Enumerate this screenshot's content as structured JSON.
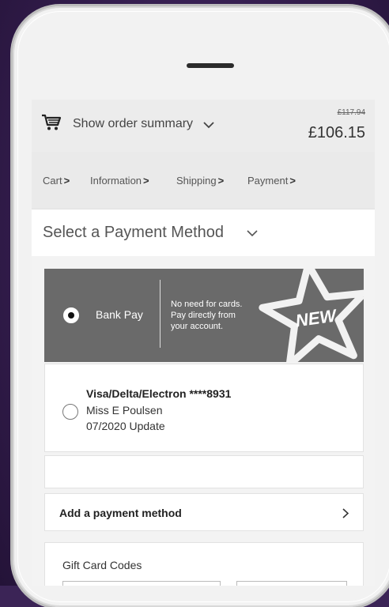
{
  "order_summary": {
    "label": "Show order summary",
    "original_price": "£117.94",
    "price": "£106.15",
    "icons": [
      "cart-icon",
      "chevron-down-icon"
    ]
  },
  "breadcrumb": [
    {
      "label": "Cart"
    },
    {
      "label": "Information"
    },
    {
      "label": "Shipping"
    },
    {
      "label": "Payment"
    }
  ],
  "payment_section": {
    "title": "Select a Payment Method"
  },
  "bank_pay": {
    "label": "Bank Pay",
    "description_lines": [
      "No need for cards.",
      "Pay directly from",
      "your account."
    ],
    "badge": "NEW",
    "selected": true
  },
  "saved_card": {
    "title": "Visa/Delta/Electron ****8931",
    "name": "Miss E Poulsen",
    "expiry": "07/2020 Update",
    "selected": false
  },
  "add_payment": {
    "label": "Add a payment method"
  },
  "gift_card": {
    "label": "Gift Card Codes"
  },
  "colors": {
    "background": "#3b2456",
    "bank_pay_panel": "#6a6a6a",
    "phone_body": "#f2f2f2"
  }
}
